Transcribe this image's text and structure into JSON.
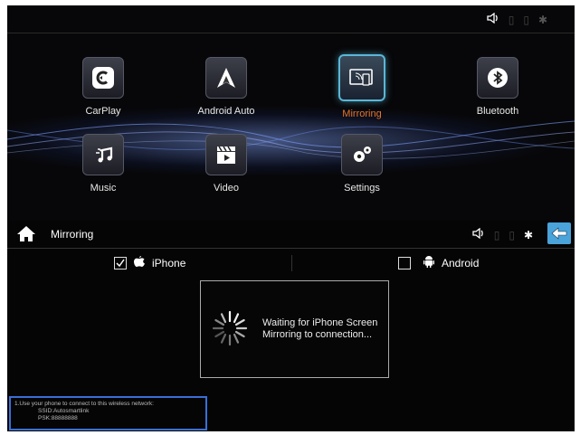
{
  "launcher": {
    "apps": [
      {
        "label": "CarPlay",
        "icon": "carplay-icon"
      },
      {
        "label": "Android Auto",
        "icon": "android-auto-icon"
      },
      {
        "label": "Mirroring",
        "icon": "mirroring-icon",
        "active": true
      },
      {
        "label": "Bluetooth",
        "icon": "bluetooth-icon"
      },
      {
        "label": "Music",
        "icon": "music-icon"
      },
      {
        "label": "Video",
        "icon": "video-icon"
      },
      {
        "label": "Settings",
        "icon": "settings-icon"
      }
    ]
  },
  "header": {
    "title": "Mirroring"
  },
  "modes": {
    "iphone_label": "iPhone",
    "iphone_checked": true,
    "android_label": "Android",
    "android_checked": false
  },
  "status_box": {
    "line1": "Waiting for iPhone Screen",
    "line2": "Mirroring to connection..."
  },
  "network_info": {
    "line1": "1.Use your phone to connect to this wireless network:",
    "ssid": "SSID:Autosmartlink",
    "psk": "PSK:88888888"
  },
  "colors": {
    "accent_orange": "#e8742a",
    "accent_blue": "#4aa3d9",
    "info_border": "#3a6fd8"
  }
}
